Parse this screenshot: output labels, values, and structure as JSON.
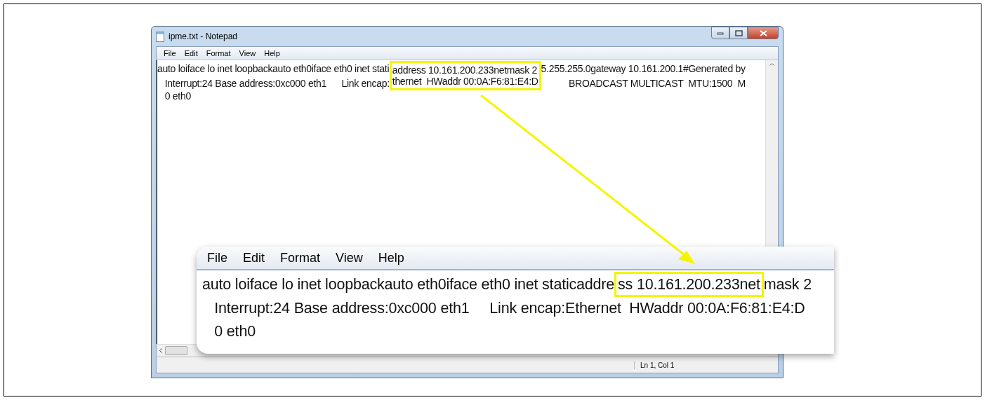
{
  "window": {
    "title": "ipme.txt - Notepad",
    "menu": [
      "File",
      "Edit",
      "Format",
      "View",
      "Help"
    ],
    "editor_lines": [
      {
        "left": "auto loiface lo inet loopbackauto eth0iface eth0 inet stati",
        "highlighted": "address 10.161.200.233netmask 2",
        "right": "5.255.255.0gateway 10.161.200.1#Generated by"
      },
      {
        "left": "   Interrupt:24 Base address:0xc000 eth1      Link encap:",
        "highlighted": "thernet  HWaddr 00:0A:F6:81:E4:D",
        "right": "           BROADCAST MULTICAST  MTU:1500  M"
      },
      {
        "left": "   0 eth0"
      }
    ],
    "status_bar": "Ln 1, Col 1"
  },
  "callout": {
    "menu": [
      "File",
      "Edit",
      "Format",
      "View",
      "Help"
    ],
    "editor_lines": [
      {
        "left": "auto loiface lo inet loopbackauto eth0iface eth0 inet staticaddre",
        "highlighted": "ss 10.161.200.233net",
        "right": "mask 2"
      },
      {
        "left": "   Interrupt:24 Base address:0xc000 eth1     Link encap:Ethernet  HWaddr 00:0A:F6:81:E4:D"
      },
      {
        "left": "   0 eth0"
      }
    ]
  }
}
